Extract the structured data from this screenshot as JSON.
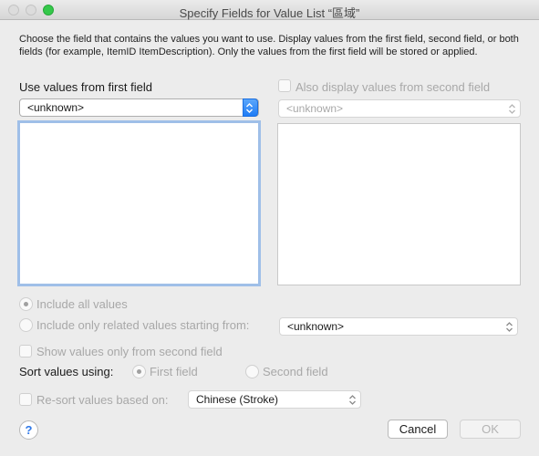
{
  "window": {
    "title": "Specify Fields for Value List “區域”"
  },
  "description": "Choose the field that contains the values you want to use.  Display values from the first field, second field, or both fields (for example, ItemID ItemDescription). Only the values from the first field will be stored or applied.",
  "first_field": {
    "label": "Use values from first field",
    "popup_value": "<unknown>"
  },
  "second_field": {
    "checkbox_label": "Also display values from second field",
    "popup_value": "<unknown>"
  },
  "options": {
    "include_all_label": "Include all values",
    "include_related_label": "Include only related values starting from:",
    "related_popup_value": "<unknown>",
    "show_second_only_label": "Show values only from second field",
    "sort_label": "Sort values using:",
    "sort_first_label": "First field",
    "sort_second_label": "Second field",
    "resort_label": "Re-sort values based on:",
    "resort_popup_value": "Chinese (Stroke)"
  },
  "buttons": {
    "help": "?",
    "cancel": "Cancel",
    "ok": "OK"
  },
  "colors": {
    "accent": "#1f7cf5",
    "focus_ring": "#9fbfe8",
    "zoom_button": "#34c84a"
  }
}
